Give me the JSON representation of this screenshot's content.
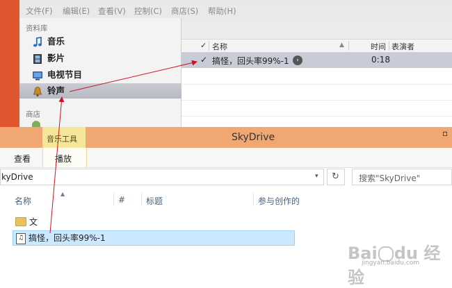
{
  "itunes": {
    "menu": [
      "文件(F)",
      "编辑(E)",
      "查看(V)",
      "控制(C)",
      "商店(S)",
      "帮助(H)"
    ],
    "sidebar": {
      "library_header": "资料库",
      "items": [
        {
          "label": "音乐",
          "icon": "music-note-icon"
        },
        {
          "label": "影片",
          "icon": "film-icon"
        },
        {
          "label": "电视节目",
          "icon": "tv-icon"
        },
        {
          "label": "铃声",
          "icon": "bell-icon",
          "selected": true
        }
      ],
      "store_header": "商店",
      "store_item_partial": "i..."
    },
    "grid": {
      "columns": {
        "check": "✓",
        "name": "名称",
        "time": "时间",
        "artist": "表演者"
      },
      "rows": [
        {
          "checked": "✓",
          "name": "搞怪，回头率99%-1",
          "time": "0:18",
          "artist": ""
        }
      ]
    }
  },
  "explorer": {
    "tool_tab": "音乐工具",
    "title": "SkyDrive",
    "ribbon_tabs": [
      "查看",
      "播放"
    ],
    "address": "kyDrive",
    "search_placeholder": "搜索\"SkyDrive\"",
    "columns": {
      "name": "名称",
      "number": "#",
      "title": "标题",
      "contrib": "参与创作的"
    },
    "files": [
      {
        "name": "文档",
        "icon": "folder-icon"
      },
      {
        "name": "搞怪，回头率99%-1",
        "icon": "music-file-icon",
        "selected": true
      }
    ]
  },
  "watermark": {
    "logo": "Baidu经验",
    "url": "jingyan.baidu.com"
  },
  "colors": {
    "orange": "#e0562e",
    "titlebar": "#f0a772",
    "tool_tab": "#f6e69a",
    "annotation": "#cc1122",
    "selection": "#cce8ff"
  }
}
